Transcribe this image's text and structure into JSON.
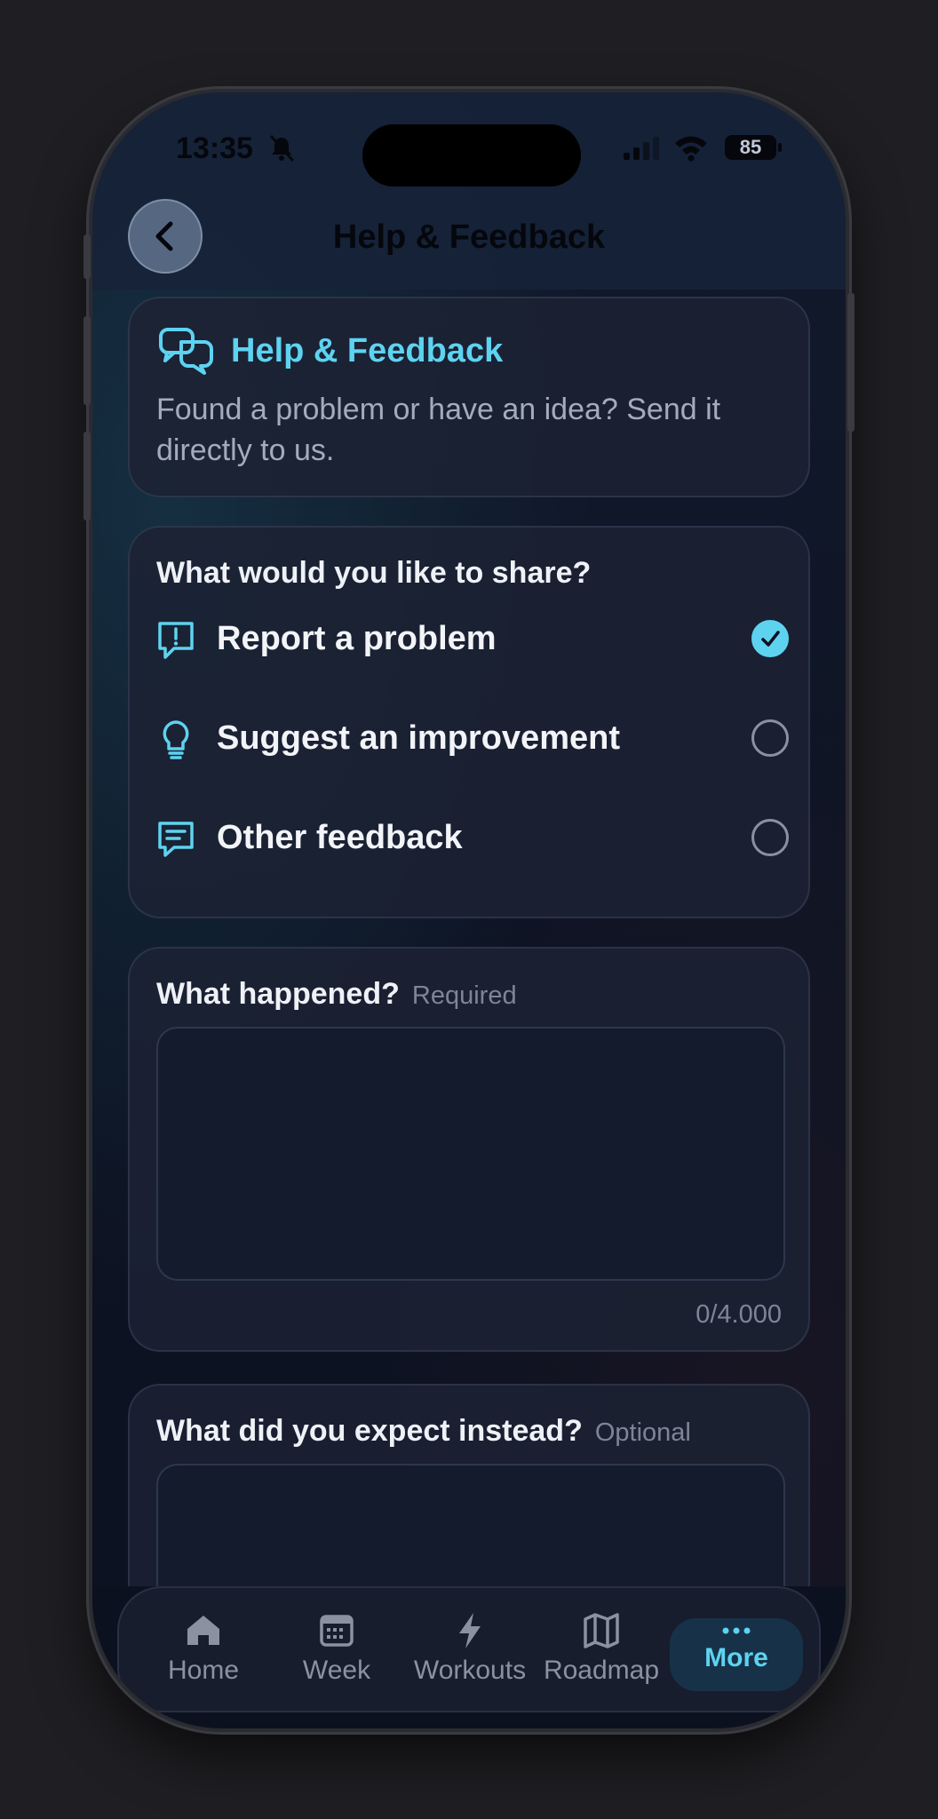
{
  "status": {
    "time": "13:35",
    "battery": "85"
  },
  "header": {
    "title": "Help & Feedback"
  },
  "intro": {
    "title": "Help & Feedback",
    "body": "Found a problem or have an idea? Send it directly to us."
  },
  "choice": {
    "question": "What would you like to share?",
    "options": [
      {
        "label": "Report a problem",
        "icon": "alert-bubble-icon",
        "selected": true
      },
      {
        "label": "Suggest an improvement",
        "icon": "lightbulb-icon",
        "selected": false
      },
      {
        "label": "Other feedback",
        "icon": "message-icon",
        "selected": false
      }
    ]
  },
  "field_happened": {
    "label": "What happened?",
    "hint": "Required",
    "value": "",
    "counter": "0/4.000"
  },
  "field_expected": {
    "label": "What did you expect instead?",
    "hint": "Optional",
    "value": ""
  },
  "tabs": [
    {
      "label": "Home",
      "icon": "home-icon"
    },
    {
      "label": "Week",
      "icon": "calendar-icon"
    },
    {
      "label": "Workouts",
      "icon": "bolt-icon"
    },
    {
      "label": "Roadmap",
      "icon": "map-icon"
    },
    {
      "label": "More",
      "icon": "more-icon",
      "active": true
    }
  ],
  "colors": {
    "accent": "#5dd3f0",
    "background": "#0e1424",
    "card": "#1c2234"
  }
}
